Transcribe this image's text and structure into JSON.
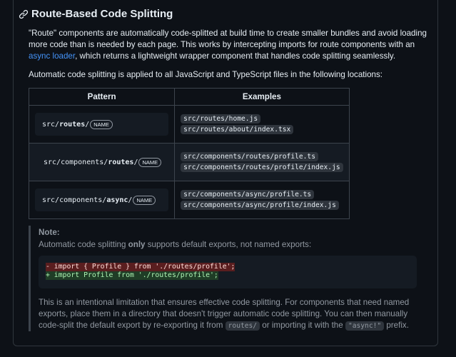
{
  "section": {
    "title": "Route-Based Code Splitting",
    "icon": "link-icon"
  },
  "intro": {
    "before_link": "\"Route\" components are automatically code-splitted at build time to create smaller bundles and avoid loading more code than is needed by each page. This works by intercepting imports for route components with an ",
    "link_text": "async loader",
    "after_link": ", which returns a lightweight wrapper component that handles code splitting seamlessly."
  },
  "locations_text": "Automatic code splitting is applied to all JavaScript and TypeScript files in the following locations:",
  "table": {
    "headers": [
      "Pattern",
      "Examples"
    ],
    "rows": [
      {
        "prefix": "src/",
        "bold": "routes",
        "suffix": "/",
        "badge": "NAME",
        "examples": [
          "src/routes/home.js",
          "src/routes/about/index.tsx"
        ]
      },
      {
        "prefix": "src/components/",
        "bold": "routes",
        "suffix": "/",
        "badge": "NAME",
        "examples": [
          "src/components/routes/profile.ts",
          "src/components/routes/profile/index.js"
        ]
      },
      {
        "prefix": "src/components/",
        "bold": "async",
        "suffix": "/",
        "badge": "NAME",
        "examples": [
          "src/components/async/profile.ts",
          "src/components/async/profile/index.js"
        ]
      }
    ]
  },
  "note": {
    "title": "Note:",
    "line_before": "Automatic code splitting ",
    "line_bold": "only",
    "line_after": " supports default exports, not named exports:",
    "code_removed": "- import { Profile } from './routes/profile';",
    "code_added": "+ import Profile from './routes/profile';",
    "body_part1": "This is an intentional limitation that ensures effective code splitting. For components that need named exports, place them in a directory that doesn't trigger automatic code splitting. You can then manually code-split the default export by re-exporting it from ",
    "body_code1": "routes/",
    "body_part2": " or importing it with the ",
    "body_code2": "\"async!\"",
    "body_part3": " prefix."
  },
  "colors": {
    "link": "#4493f8",
    "diff_removed_bg": "#5a1e1f",
    "diff_added_bg": "#1f3d26"
  }
}
